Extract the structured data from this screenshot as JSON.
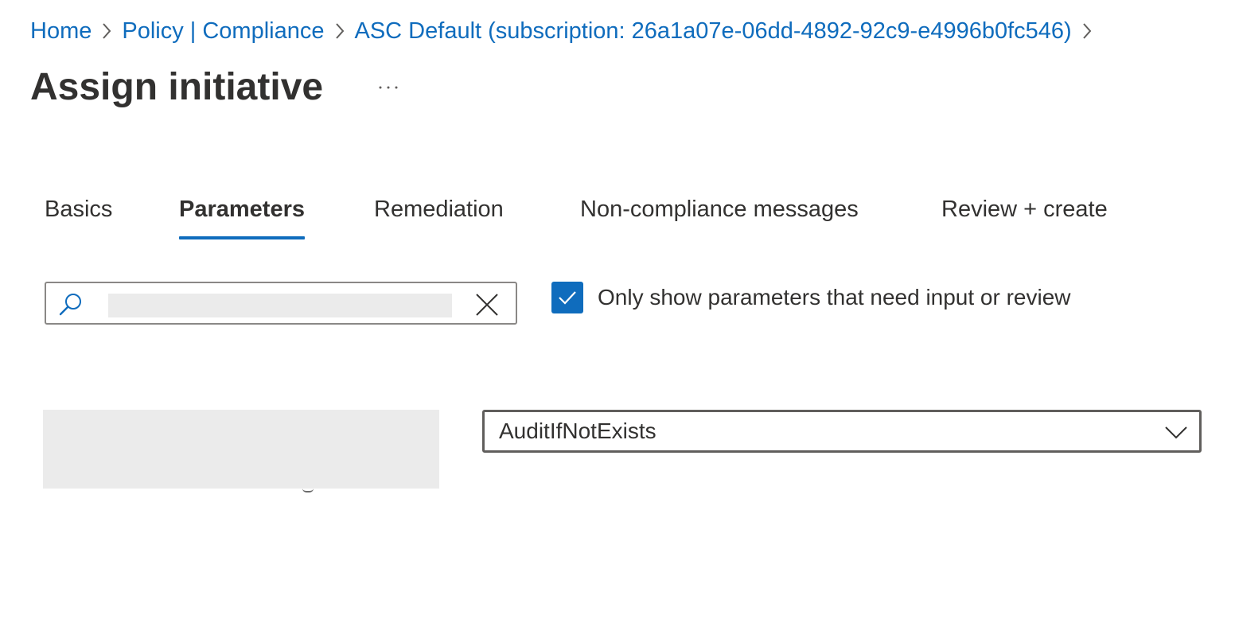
{
  "breadcrumb": {
    "items": [
      "Home",
      "Policy | Compliance",
      "ASC Default (subscription: 26a1a07e-06dd-4892-92c9-e4996b0fc546)"
    ]
  },
  "page": {
    "title": "Assign initiative",
    "more_label": "···"
  },
  "tabs": [
    {
      "label": "Basics",
      "active": false
    },
    {
      "label": "Parameters",
      "active": true
    },
    {
      "label": "Remediation",
      "active": false
    },
    {
      "label": "Non-compliance messages",
      "active": false
    },
    {
      "label": "Review + create",
      "active": false
    }
  ],
  "search": {
    "value": "",
    "placeholder": "",
    "icon": "search-icon",
    "clear_icon": "close-icon"
  },
  "filter": {
    "checked": true,
    "label": "Only show parameters that need input or review"
  },
  "parameter": {
    "name": "",
    "value": "AuditIfNotExists"
  },
  "colors": {
    "accent": "#0f6cbd",
    "text": "#323130",
    "border": "#8a8886",
    "redacted": "#ebebeb"
  }
}
